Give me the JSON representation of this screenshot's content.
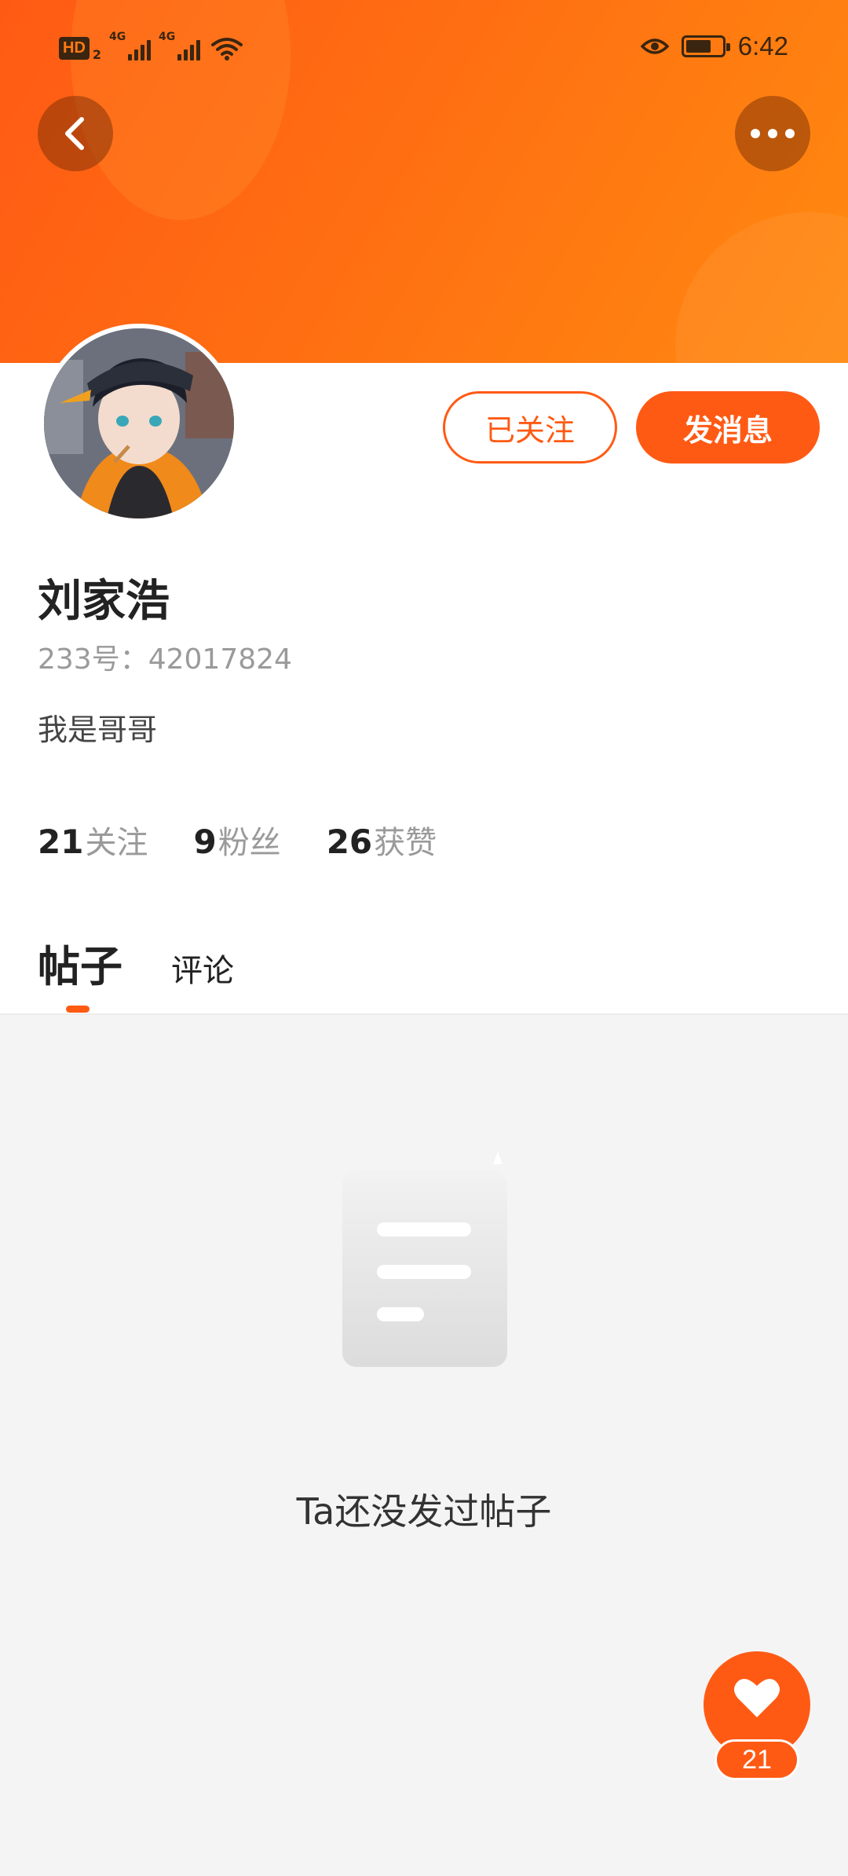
{
  "status_bar": {
    "hd_label": "HD",
    "hd_sub": "2",
    "network_1": "4G",
    "network_2": "4G",
    "time": "6:42"
  },
  "profile": {
    "name": "刘家浩",
    "id_text": "233号：42017824",
    "bio": "我是哥哥"
  },
  "actions": {
    "follow_label": "已关注",
    "message_label": "发消息"
  },
  "stats": [
    {
      "num": "21",
      "label": "关注"
    },
    {
      "num": "9",
      "label": "粉丝"
    },
    {
      "num": "26",
      "label": "获赞"
    }
  ],
  "tabs": {
    "posts": "帖子",
    "comments": "评论"
  },
  "empty": {
    "message": "Ta还没发过帖子"
  },
  "like": {
    "count": "21"
  },
  "icons": {
    "back": "chevron-left-icon",
    "more": "more-dots-icon",
    "like": "heart-icon",
    "empty": "document-icon"
  },
  "colors": {
    "accent": "#ff5a14"
  }
}
